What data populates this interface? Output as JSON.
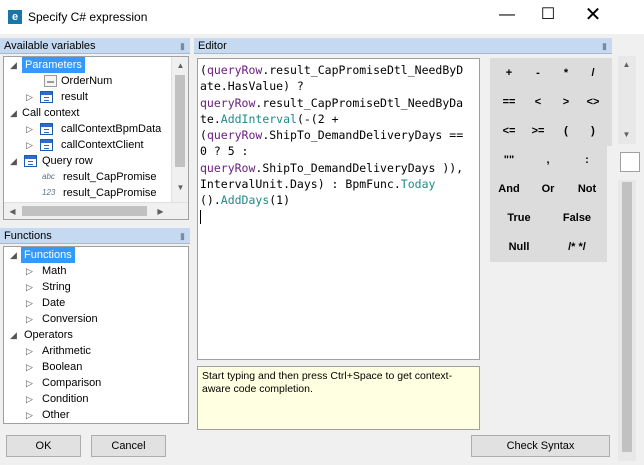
{
  "window": {
    "title": "Specify C# expression",
    "app_icon_letter": "e",
    "minimize_glyph": "—",
    "maximize_glyph": "☐",
    "close_glyph": "✕"
  },
  "variables_panel": {
    "header": "Available variables",
    "items": [
      {
        "label": "Parameters",
        "selected": true
      },
      {
        "label": "OrderNum"
      },
      {
        "label": "result"
      },
      {
        "label": "Call context"
      },
      {
        "label": "callContextBpmData"
      },
      {
        "label": "callContextClient"
      },
      {
        "label": "Query row"
      },
      {
        "label": "result_CapPromise",
        "tag": "abc"
      },
      {
        "label": "result_CapPromise",
        "tag": "123"
      }
    ]
  },
  "functions_panel": {
    "header": "Functions",
    "items": [
      {
        "label": "Functions",
        "selected": true
      },
      {
        "label": "Math"
      },
      {
        "label": "String"
      },
      {
        "label": "Date"
      },
      {
        "label": "Conversion"
      },
      {
        "label": "Operators"
      },
      {
        "label": "Arithmetic"
      },
      {
        "label": "Boolean"
      },
      {
        "label": "Comparison"
      },
      {
        "label": "Condition"
      },
      {
        "label": "Other"
      }
    ]
  },
  "editor": {
    "header": "Editor",
    "lines": [
      [
        "(",
        "queryRow",
        ".result_CapPromiseDtl_NeedByD"
      ],
      [
        "ate.HasValue) ?"
      ],
      [
        "queryRow",
        ".result_CapPromiseDtl_NeedByDa"
      ],
      [
        "te.",
        "AddInterval",
        "(-(2 +"
      ],
      [
        "(",
        "queryRow",
        ".ShipTo_DemandDeliveryDays =="
      ],
      [
        "0 ? 5 :"
      ],
      [
        "queryRow",
        ".ShipTo_DemandDeliveryDays )),"
      ],
      [
        "IntervalUnit.Days) : BpmFunc.",
        "Today"
      ],
      [
        "().",
        "AddDays",
        "(1)"
      ]
    ],
    "hint": "Start typing and then press Ctrl+Space to get context-aware code completion."
  },
  "operators": {
    "row1": [
      "+",
      "-",
      "*",
      "/"
    ],
    "row2": [
      "==",
      "<",
      ">",
      "<>"
    ],
    "row3": [
      "<=",
      ">=",
      "(",
      ")"
    ],
    "row4": [
      "\"\"",
      ",",
      ":"
    ],
    "row5": [
      "And",
      "Or",
      "Not"
    ],
    "row6": [
      "True",
      "False"
    ],
    "row7": [
      "Null",
      "/* */"
    ]
  },
  "footer": {
    "ok": "OK",
    "cancel": "Cancel",
    "check_syntax": "Check Syntax"
  },
  "colors": {
    "selection": "#3399ff",
    "panel_header": "#c5d9f1",
    "keyword": "#6a1e80",
    "method": "#1f8a8a"
  }
}
